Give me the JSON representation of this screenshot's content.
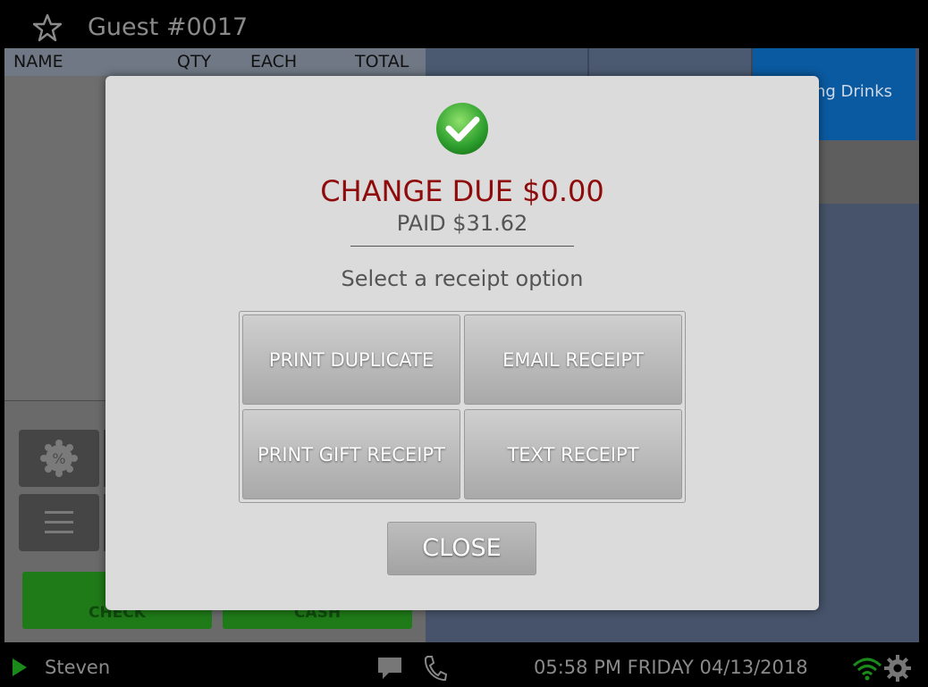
{
  "header": {
    "guest_title": "Guest #0017",
    "star_icon": "star-icon"
  },
  "order_table": {
    "columns": [
      "NAME",
      "QTY",
      "EACH",
      "TOTAL"
    ]
  },
  "categories": {
    "highlighted_label": "ng Drinks"
  },
  "left_actions": {
    "check_label": "CHECK",
    "cash_label": "CASH",
    "discount_icon": "discount-icon",
    "menu_icon": "menu-icon"
  },
  "modal": {
    "change_due": "CHANGE DUE $0.00",
    "paid": "PAID $31.62",
    "prompt": "Select a receipt option",
    "options": [
      "PRINT DUPLICATE",
      "EMAIL RECEIPT",
      "PRINT GIFT RECEIPT",
      "TEXT RECEIPT"
    ],
    "close_label": "CLOSE",
    "change_color": "#8f0b0b",
    "success_color": "#2ea02e"
  },
  "footer": {
    "user": "Steven",
    "datetime": "05:58 PM FRIDAY 04/13/2018",
    "wifi_color": "#1a8a1a"
  }
}
